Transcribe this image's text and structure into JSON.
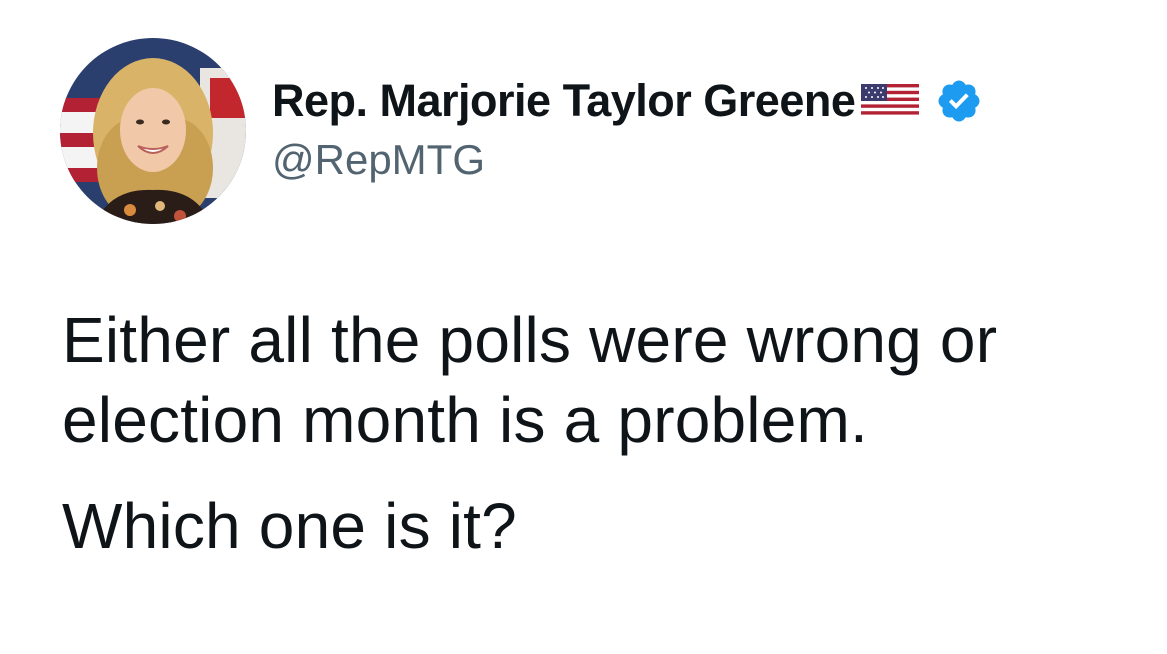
{
  "author": {
    "display_name": "Rep. Marjorie Taylor Greene",
    "handle": "@RepMTG",
    "verified_color": "#1d9bf0"
  },
  "tweet": {
    "paragraphs": [
      "Either all the polls were wrong or election month is a problem.",
      "Which one is it?"
    ]
  },
  "icons": {
    "flag": "us-flag-icon",
    "verified": "verified-badge-icon"
  }
}
